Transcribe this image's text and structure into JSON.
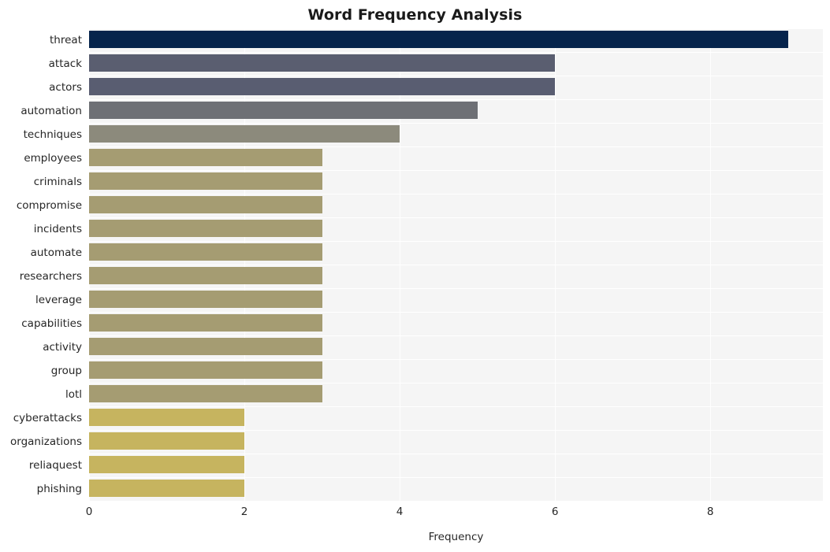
{
  "chart_data": {
    "type": "bar",
    "orientation": "horizontal",
    "title": "Word Frequency Analysis",
    "xlabel": "Frequency",
    "ylabel": "",
    "categories": [
      "threat",
      "attack",
      "actors",
      "automation",
      "techniques",
      "employees",
      "criminals",
      "compromise",
      "incidents",
      "automate",
      "researchers",
      "leverage",
      "capabilities",
      "activity",
      "group",
      "lotl",
      "cyberattacks",
      "organizations",
      "reliaquest",
      "phishing"
    ],
    "values": [
      9,
      6,
      6,
      5,
      4,
      3,
      3,
      3,
      3,
      3,
      3,
      3,
      3,
      3,
      3,
      3,
      2,
      2,
      2,
      2
    ],
    "bar_colors": [
      "#06244c",
      "#5a5e70",
      "#595d71",
      "#6e7075",
      "#8c8a7c",
      "#a59c72",
      "#a59c72",
      "#a59c72",
      "#a59c72",
      "#a59c72",
      "#a59c72",
      "#a59c72",
      "#a59c72",
      "#a59c72",
      "#a59c72",
      "#a59c72",
      "#c6b45f",
      "#c6b45f",
      "#c6b45f",
      "#c6b45f"
    ],
    "xticks": [
      "0",
      "2",
      "4",
      "6",
      "8"
    ],
    "xtick_values": [
      0,
      2,
      4,
      6,
      8
    ],
    "xlim": [
      0,
      9.45
    ],
    "grid": true,
    "grid_color": "#ffffff",
    "plot_background": "#f5f5f5",
    "figure_background": "#ffffff",
    "legend": "none"
  }
}
